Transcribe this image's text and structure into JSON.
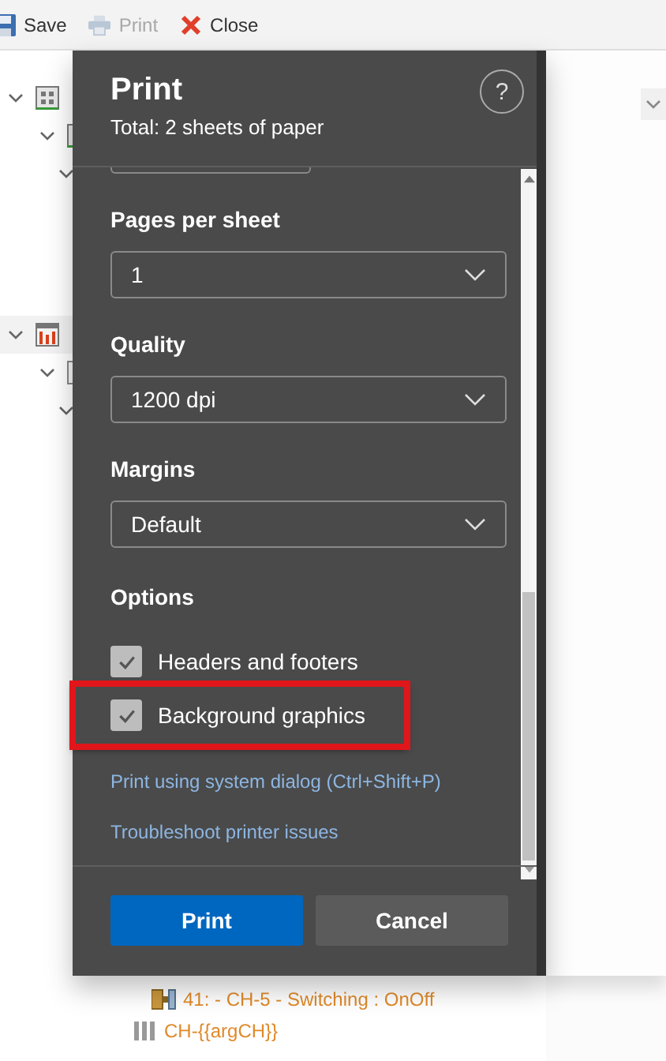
{
  "toolbar": [
    {
      "label": "Save",
      "disabled": false
    },
    {
      "label": "Print",
      "disabled": true
    },
    {
      "label": "Close",
      "disabled": false
    }
  ],
  "dialog": {
    "title": "Print",
    "subtitle": "Total: 2 sheets of paper",
    "help": "?",
    "settings": [
      {
        "label": "Pages per sheet",
        "value": "1"
      },
      {
        "label": "Quality",
        "value": "1200 dpi"
      },
      {
        "label": "Margins",
        "value": "Default"
      }
    ],
    "options_heading": "Options",
    "options": [
      {
        "label": "Headers and footers",
        "checked": true,
        "highlighted": false
      },
      {
        "label": "Background graphics",
        "checked": true,
        "highlighted": true
      }
    ],
    "links": [
      "Print using system dialog (Ctrl+Shift+P)",
      "Troubleshoot printer issues"
    ],
    "buttons": [
      {
        "label": "Print",
        "kind": "primary"
      },
      {
        "label": "Cancel",
        "kind": "secondary"
      }
    ]
  },
  "tree_rows": [
    {
      "label": "41: - CH-5 - Switching : OnOff",
      "kind": "switch"
    },
    {
      "label": "CH-{{argCH}}",
      "kind": "channel"
    }
  ]
}
